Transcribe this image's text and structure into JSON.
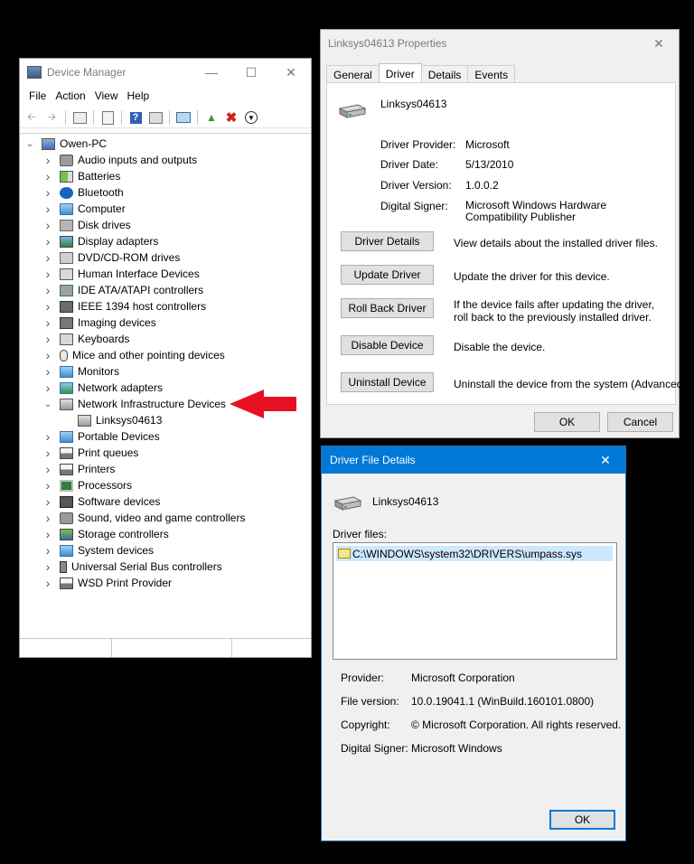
{
  "device_manager": {
    "title": "Device Manager",
    "menu": [
      "File",
      "Action",
      "View",
      "Help"
    ],
    "tree": [
      {
        "label": "Owen-PC",
        "level": 0,
        "chevron": "down",
        "icon": "computer-icon"
      },
      {
        "label": "Audio inputs and outputs",
        "level": 1,
        "chevron": "right",
        "icon": "speaker-icon"
      },
      {
        "label": "Batteries",
        "level": 1,
        "chevron": "right",
        "icon": "battery-icon"
      },
      {
        "label": "Bluetooth",
        "level": 1,
        "chevron": "right",
        "icon": "bluetooth-icon"
      },
      {
        "label": "Computer",
        "level": 1,
        "chevron": "right",
        "icon": "monitor-icon"
      },
      {
        "label": "Disk drives",
        "level": 1,
        "chevron": "right",
        "icon": "disk-icon"
      },
      {
        "label": "Display adapters",
        "level": 1,
        "chevron": "right",
        "icon": "display-adapter-icon"
      },
      {
        "label": "DVD/CD-ROM drives",
        "level": 1,
        "chevron": "right",
        "icon": "dvd-icon"
      },
      {
        "label": "Human Interface Devices",
        "level": 1,
        "chevron": "right",
        "icon": "keyboard-icon"
      },
      {
        "label": "IDE ATA/ATAPI controllers",
        "level": 1,
        "chevron": "right",
        "icon": "controller-icon"
      },
      {
        "label": "IEEE 1394 host controllers",
        "level": 1,
        "chevron": "right",
        "icon": "plug-icon"
      },
      {
        "label": "Imaging devices",
        "level": 1,
        "chevron": "right",
        "icon": "camera-icon"
      },
      {
        "label": "Keyboards",
        "level": 1,
        "chevron": "right",
        "icon": "keyboard-icon"
      },
      {
        "label": "Mice and other pointing devices",
        "level": 1,
        "chevron": "right",
        "icon": "mouse-icon"
      },
      {
        "label": "Monitors",
        "level": 1,
        "chevron": "right",
        "icon": "monitor-icon"
      },
      {
        "label": "Network adapters",
        "level": 1,
        "chevron": "right",
        "icon": "network-icon"
      },
      {
        "label": "Network Infrastructure Devices",
        "level": 1,
        "chevron": "down",
        "icon": "router-icon"
      },
      {
        "label": "Linksys04613",
        "level": 2,
        "chevron": "",
        "icon": "router-icon"
      },
      {
        "label": "Portable Devices",
        "level": 1,
        "chevron": "right",
        "icon": "monitor-icon"
      },
      {
        "label": "Print queues",
        "level": 1,
        "chevron": "right",
        "icon": "printer-icon"
      },
      {
        "label": "Printers",
        "level": 1,
        "chevron": "right",
        "icon": "printer-icon"
      },
      {
        "label": "Processors",
        "level": 1,
        "chevron": "right",
        "icon": "chip-icon"
      },
      {
        "label": "Software devices",
        "level": 1,
        "chevron": "right",
        "icon": "software-icon"
      },
      {
        "label": "Sound, video and game controllers",
        "level": 1,
        "chevron": "right",
        "icon": "speaker-icon"
      },
      {
        "label": "Storage controllers",
        "level": 1,
        "chevron": "right",
        "icon": "storage-icon"
      },
      {
        "label": "System devices",
        "level": 1,
        "chevron": "right",
        "icon": "monitor-icon"
      },
      {
        "label": "Universal Serial Bus controllers",
        "level": 1,
        "chevron": "right",
        "icon": "usb-icon"
      },
      {
        "label": "WSD Print Provider",
        "level": 1,
        "chevron": "right",
        "icon": "printer-icon"
      }
    ]
  },
  "properties": {
    "title": "Linksys04613 Properties",
    "tabs": [
      "General",
      "Driver",
      "Details",
      "Events"
    ],
    "active_tab": "Driver",
    "device_name": "Linksys04613",
    "fields": [
      {
        "label": "Driver Provider:",
        "value": "Microsoft"
      },
      {
        "label": "Driver Date:",
        "value": "5/13/2010"
      },
      {
        "label": "Driver Version:",
        "value": "1.0.0.2"
      },
      {
        "label": "Digital Signer:",
        "value": "Microsoft Windows Hardware Compatibility Publisher"
      }
    ],
    "actions": [
      {
        "button": "Driver Details",
        "desc": "View details about the installed driver files."
      },
      {
        "button": "Update Driver",
        "desc": "Update the driver for this device."
      },
      {
        "button": "Roll Back Driver",
        "desc": "If the device fails after updating the driver, roll back to the previously installed driver."
      },
      {
        "button": "Disable Device",
        "desc": "Disable the device."
      },
      {
        "button": "Uninstall Device",
        "desc": "Uninstall the device from the system (Advanced)."
      }
    ],
    "ok_label": "OK",
    "cancel_label": "Cancel"
  },
  "driver_file_details": {
    "title": "Driver File Details",
    "device_name": "Linksys04613",
    "files_label": "Driver files:",
    "files": [
      "C:\\WINDOWS\\system32\\DRIVERS\\umpass.sys"
    ],
    "fields": [
      {
        "label": "Provider:",
        "value": "Microsoft Corporation"
      },
      {
        "label": "File version:",
        "value": "10.0.19041.1 (WinBuild.160101.0800)"
      },
      {
        "label": "Copyright:",
        "value": "© Microsoft Corporation. All rights reserved."
      },
      {
        "label": "Digital Signer:",
        "value": "Microsoft Windows"
      }
    ],
    "ok_label": "OK"
  },
  "colors": {
    "accent": "#0078d7",
    "arrow": "#e81123"
  }
}
